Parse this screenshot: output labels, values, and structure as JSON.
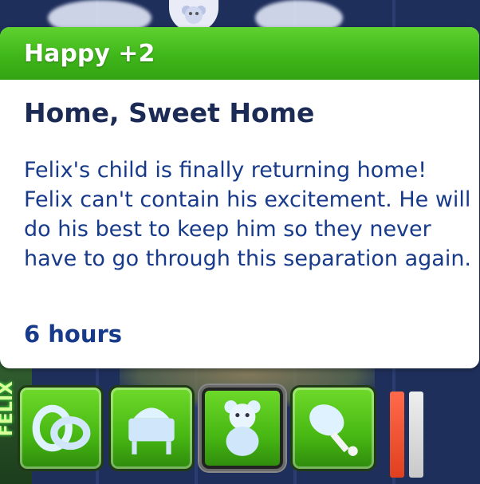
{
  "notification": {
    "header": "Happy +2",
    "title": "Home, Sweet Home",
    "description": "Felix's child is finally returning home! Felix can't contain his excitement. He will do his best to keep him so they never have to go through this separation again.",
    "duration": "6 hours"
  },
  "moodlets": [
    {
      "icon": "rings-icon"
    },
    {
      "icon": "crib-icon"
    },
    {
      "icon": "teddy-bear-icon",
      "selected": true
    },
    {
      "icon": "drumstick-icon"
    }
  ],
  "side_label": "FELIX",
  "colors": {
    "header_green": "#3fb71a",
    "title_navy": "#1b2b55",
    "text_blue": "#173a8a",
    "level_red": "#e0401f"
  }
}
